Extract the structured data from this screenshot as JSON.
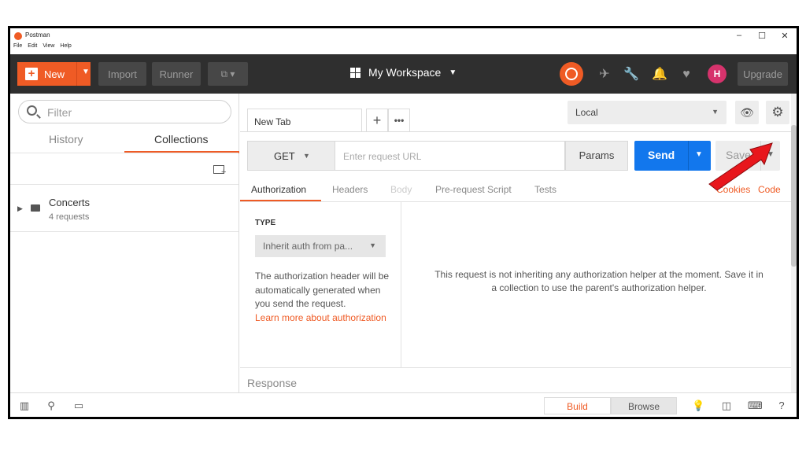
{
  "titlebar": {
    "app_name": "Postman",
    "menu": [
      "File",
      "Edit",
      "View",
      "Help"
    ],
    "minimize": "–",
    "maximize": "☐",
    "close": "✕"
  },
  "header": {
    "new_label": "New",
    "import_label": "Import",
    "runner_label": "Runner",
    "workspace_label": "My Workspace",
    "avatar_initial": "H",
    "upgrade_label": "Upgrade",
    "accent_color": "#ef5b25",
    "bg_color": "#2f2f2f"
  },
  "sidebar": {
    "filter_placeholder": "Filter",
    "tabs": [
      {
        "label": "History",
        "active": false
      },
      {
        "label": "Collections",
        "active": true
      }
    ],
    "collections": [
      {
        "name": "Concerts",
        "count": "4 requests"
      }
    ]
  },
  "main": {
    "tab_label": "New Tab",
    "environment": "Local",
    "request": {
      "method": "GET",
      "url_placeholder": "Enter request URL",
      "params_label": "Params",
      "send_label": "Send",
      "save_label": "Save",
      "send_color": "#1277ed"
    },
    "request_tabs": [
      {
        "label": "Authorization",
        "active": true
      },
      {
        "label": "Headers",
        "active": false
      },
      {
        "label": "Body",
        "active": false,
        "disabled": true
      },
      {
        "label": "Pre-request Script",
        "active": false
      },
      {
        "label": "Tests",
        "active": false
      }
    ],
    "cookies_label": "Cookies",
    "code_label": "Code",
    "auth": {
      "type_label": "TYPE",
      "type_value": "Inherit auth from pa...",
      "description": "The authorization header will be automatically generated when you send the request.",
      "learn_more": "Learn more about authorization",
      "message": "This request is not inheriting any authorization helper at the moment. Save it in a collection to use the parent's authorization helper."
    },
    "response_label": "Response"
  },
  "statusbar": {
    "build_label": "Build",
    "browse_label": "Browse"
  }
}
